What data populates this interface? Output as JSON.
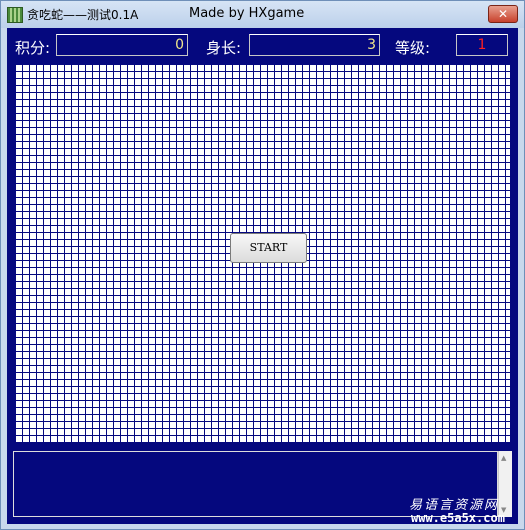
{
  "window": {
    "title": "贪吃蛇——测试0.1A",
    "credit": "Made by HXgame",
    "close_symbol": "✕",
    "icon": "snake-app-icon"
  },
  "stats": {
    "score_label": "积分:",
    "score_value": "0",
    "length_label": "身长:",
    "length_value": "3",
    "level_label": "等级:",
    "level_value": "1"
  },
  "colors": {
    "background": "#05087e",
    "score_text": "#f0e68c",
    "level_text": "#ff2020",
    "grid": "#ffffff"
  },
  "board": {
    "start_label": "START"
  },
  "log": {
    "text": ""
  },
  "watermark": {
    "top": "易语言资源网",
    "bottom": "www.e5a5x.com"
  }
}
